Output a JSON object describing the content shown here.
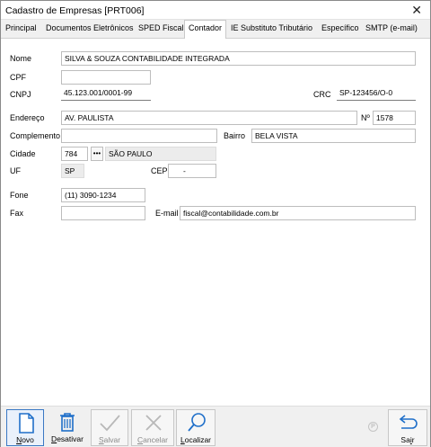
{
  "window": {
    "title": "Cadastro de Empresas [PRT006]",
    "close_glyph": "✕"
  },
  "tabs": [
    {
      "label": "Principal"
    },
    {
      "label": "Documentos Eletrônicos"
    },
    {
      "label": "SPED Fiscal"
    },
    {
      "label": "Contador",
      "active": true
    },
    {
      "label": "IE Substituto Tributário"
    },
    {
      "label": "Específico"
    },
    {
      "label": "SMTP (e-mail)"
    }
  ],
  "form": {
    "nome": {
      "label": "Nome",
      "value": "SILVA & SOUZA CONTABILIDADE INTEGRADA"
    },
    "cpf": {
      "label": "CPF",
      "value": ""
    },
    "cnpj": {
      "label": "CNPJ",
      "value": "45.123.001/0001-99"
    },
    "crc": {
      "label": "CRC",
      "value": "SP-123456/O-0"
    },
    "endereco": {
      "label": "Endereço",
      "value": "AV. PAULISTA"
    },
    "numero": {
      "label": "Nº",
      "value": "1578"
    },
    "complemento": {
      "label": "Complemento",
      "value": ""
    },
    "bairro": {
      "label": "Bairro",
      "value": "BELA VISTA"
    },
    "cidade": {
      "label": "Cidade",
      "code": "784",
      "lookup": "•••",
      "name": "SÃO PAULO"
    },
    "uf": {
      "label": "UF",
      "value": "SP"
    },
    "cep": {
      "label": "CEP",
      "value": "-"
    },
    "fone": {
      "label": "Fone",
      "value": "(11) 3090-1234"
    },
    "fax": {
      "label": "Fax",
      "value": ""
    },
    "email": {
      "label": "E-mail",
      "value": "fiscal@contabilidade.com.br"
    }
  },
  "toolbar": {
    "novo": {
      "pre": "",
      "key": "N",
      "post": "ovo"
    },
    "desativar": {
      "pre": "",
      "key": "D",
      "post": "esativar"
    },
    "salvar": {
      "pre": "",
      "key": "S",
      "post": "alvar"
    },
    "cancelar": {
      "pre": "",
      "key": "C",
      "post": "ancelar"
    },
    "localizar": {
      "pre": "",
      "key": "L",
      "post": "ocalizar"
    },
    "sair": {
      "pre": "Sa",
      "key": "i",
      "post": "r"
    },
    "p_mark": "P"
  },
  "icons": {
    "close": "close-icon",
    "novo": "new-document-icon",
    "desativar": "trash-icon",
    "salvar": "check-icon",
    "cancelar": "x-icon",
    "localizar": "search-icon",
    "sair": "exit-arrow-icon",
    "p_mark": "circle-p-icon"
  },
  "colors": {
    "accent": "#1f6fc9",
    "disabled": "#b8b8b8",
    "selected_border": "#3a78c4"
  }
}
